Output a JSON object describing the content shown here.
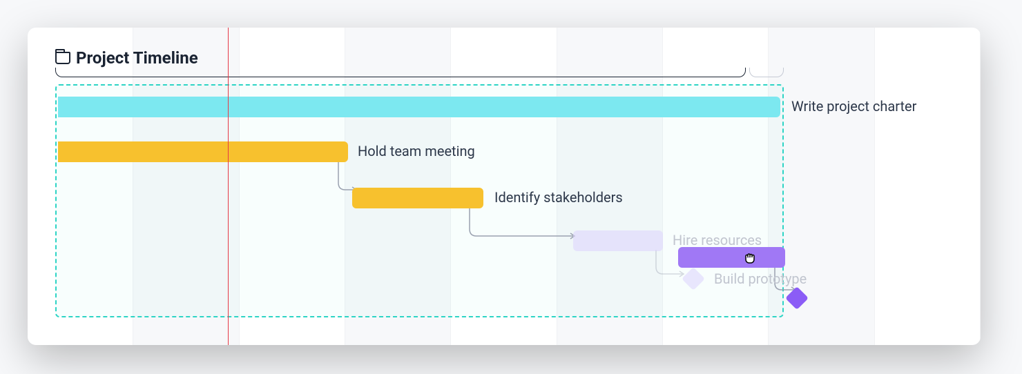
{
  "title": "Project Timeline",
  "tasks": {
    "charter": {
      "label": "Write project charter",
      "color": "cyan"
    },
    "meeting": {
      "label": "Hold team meeting",
      "color": "yellow"
    },
    "stakeholders": {
      "label": "Identify stakeholders",
      "color": "yellow"
    },
    "hire": {
      "label": "Hire resources",
      "color": "purple"
    },
    "prototype": {
      "label": "Build prototype",
      "color": "purple"
    }
  },
  "colors": {
    "cyan": "#7ce8f0",
    "yellow": "#f7c12e",
    "purple_light": "#ddd6fe",
    "purple": "#a078f5",
    "dash": "#2dd4c5",
    "today": "#e63946"
  }
}
